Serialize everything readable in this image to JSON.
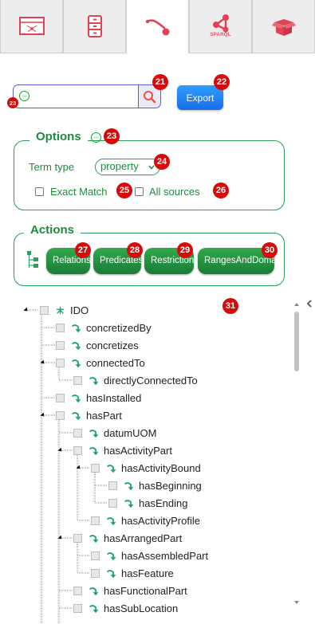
{
  "tabs": [
    {
      "name": "tab-graph",
      "icon": "graph-board-icon",
      "sub": ""
    },
    {
      "name": "tab-cabinet",
      "icon": "cabinet-icon",
      "sub": ""
    },
    {
      "name": "tab-properties",
      "icon": "property-arrow-icon",
      "sub": ""
    },
    {
      "name": "tab-sparql",
      "icon": "sparql-icon",
      "sub": "SPARQL"
    },
    {
      "name": "tab-box",
      "icon": "box-icon",
      "sub": ""
    }
  ],
  "search": {
    "placeholder": "",
    "value": ""
  },
  "export_label": "Export",
  "options": {
    "legend": "Options",
    "term_type_label": "Term type",
    "term_type_value": "property",
    "exact_match_label": "Exact Match",
    "all_sources_label": "All sources"
  },
  "actions": {
    "legend": "Actions",
    "buttons": [
      "Relations",
      "Predicates",
      "Restrictions",
      "RangesAndDomains"
    ]
  },
  "badges": [
    "21",
    "22",
    "23",
    "23",
    "24",
    "25",
    "26",
    "27",
    "28",
    "29",
    "30",
    "31"
  ],
  "tree": {
    "root": "IDO",
    "nodes": [
      "concretizedBy",
      "concretizes",
      "connectedTo",
      "directlyConnectedTo",
      "hasInstalled",
      "hasPart",
      "datumUOM",
      "hasActivityPart",
      "hasActivityBound",
      "hasBeginning",
      "hasEnding",
      "hasActivityProfile",
      "hasArrangedPart",
      "hasAssembledPart",
      "hasFeature",
      "hasFunctionalPart",
      "hasSubLocation"
    ]
  },
  "colors": {
    "accent_green": "#1f8a3e",
    "badge_red": "#d60a0a",
    "export_blue": "#1a6ee8",
    "search_border": "#5b5fc7"
  }
}
